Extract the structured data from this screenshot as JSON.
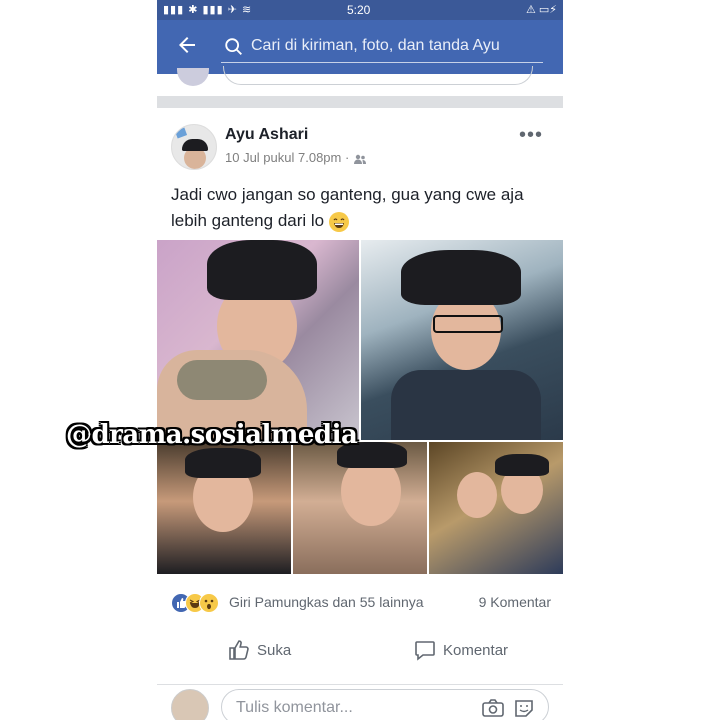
{
  "statusbar": {
    "time": "5:20"
  },
  "search": {
    "placeholder": "Cari di kiriman, foto, dan tanda Ayu"
  },
  "post": {
    "author": "Ayu Ashari",
    "timestamp": "10 Jul pukul 7.08pm",
    "text": "Jadi cwo jangan so ganteng, gua yang cwe aja lebih ganteng dari lo",
    "watermark": "@drama.sosialmedia"
  },
  "reactions": {
    "names": "Giri Pamungkas dan 55 lainnya",
    "comments": "9 Komentar"
  },
  "actions": {
    "like_label": "Suka",
    "comment_label": "Komentar"
  },
  "comment": {
    "placeholder": "Tulis komentar..."
  },
  "colors": {
    "brand": "#4267b2",
    "status": "#3b5998",
    "like_blue": "#4267b2",
    "haha_yellow": "#f7c948"
  }
}
